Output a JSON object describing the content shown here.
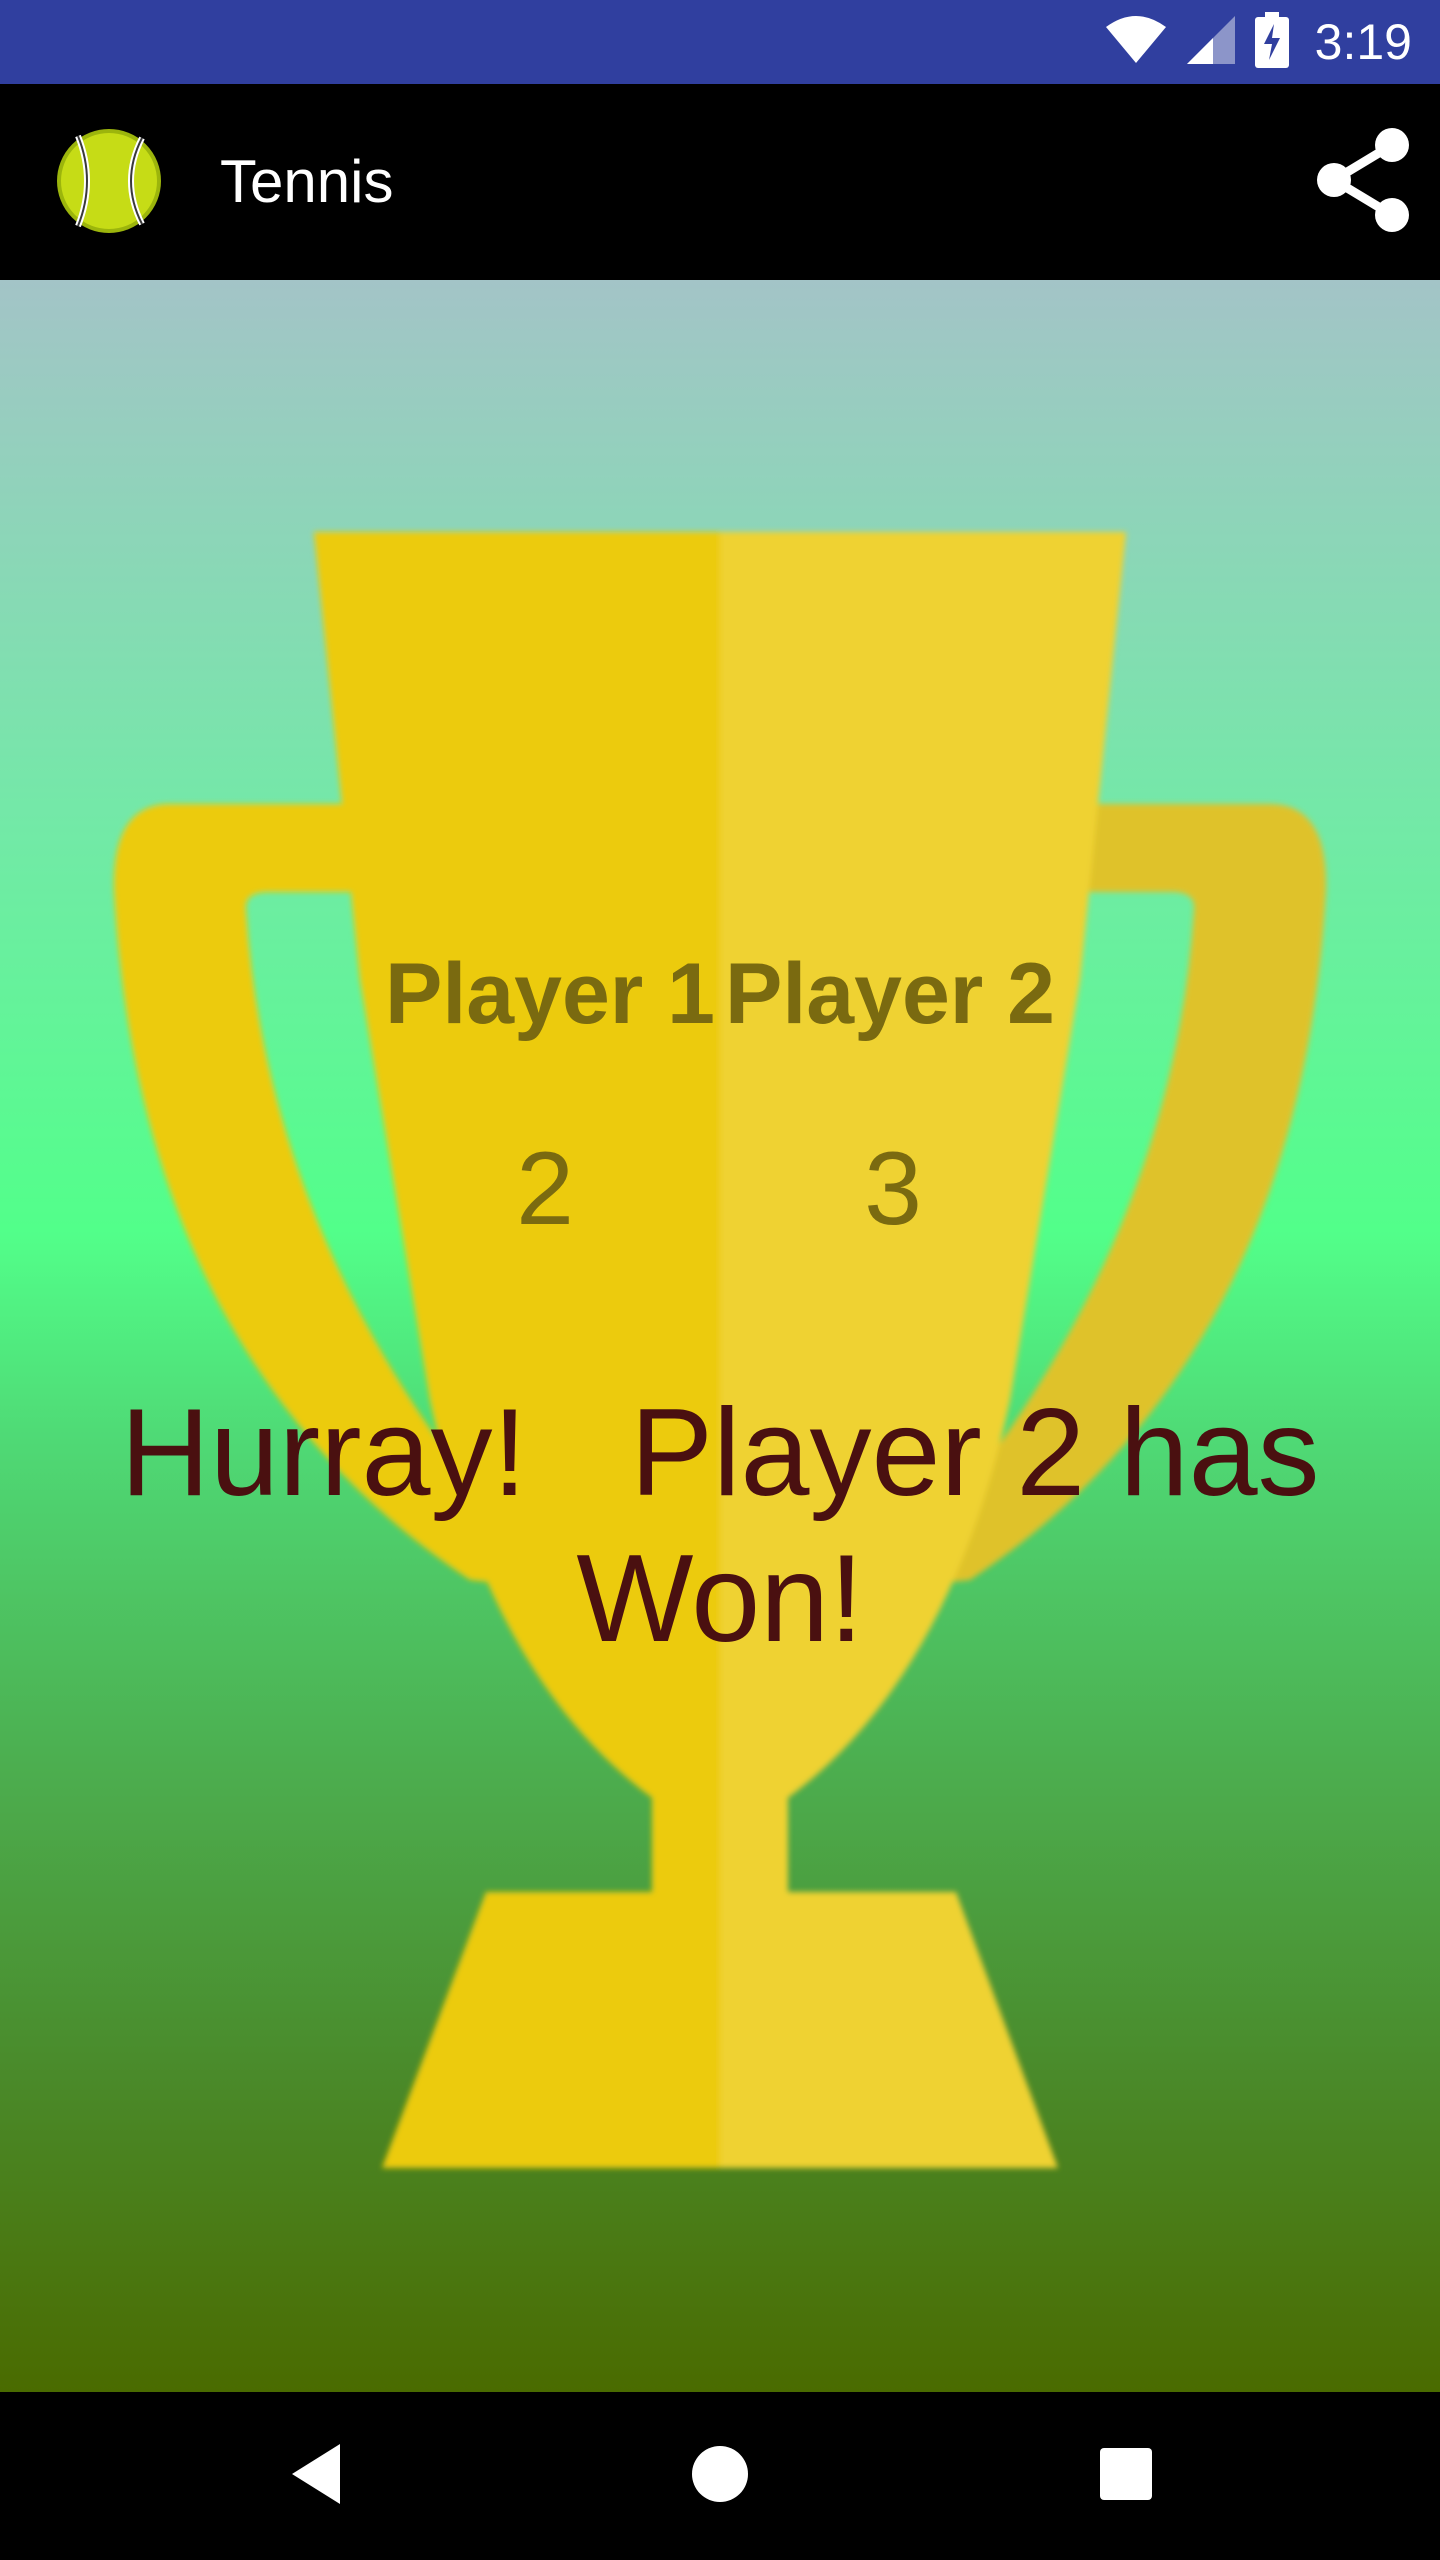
{
  "status_bar": {
    "time": "3:19",
    "icons": [
      "wifi-icon",
      "signal-icon",
      "battery-charging-icon"
    ]
  },
  "app_bar": {
    "title": "Tennis",
    "logo_icon": "tennis-ball-icon",
    "share_icon": "share-icon"
  },
  "scoreboard": {
    "player1_label": "Player 1",
    "player2_label": "Player 2",
    "player1_score": "2",
    "player2_score": "3"
  },
  "winner_message": "Hurray!   Player 2 has Won!",
  "navigation": {
    "back_icon": "back-icon",
    "home_icon": "home-icon",
    "recents_icon": "recents-icon"
  },
  "colors": {
    "status_bar": "#303f9f",
    "app_bar": "#000000",
    "trophy_gold": "#eccb0c",
    "score_text": "#7a6a10",
    "winner_text": "#4a1010"
  }
}
